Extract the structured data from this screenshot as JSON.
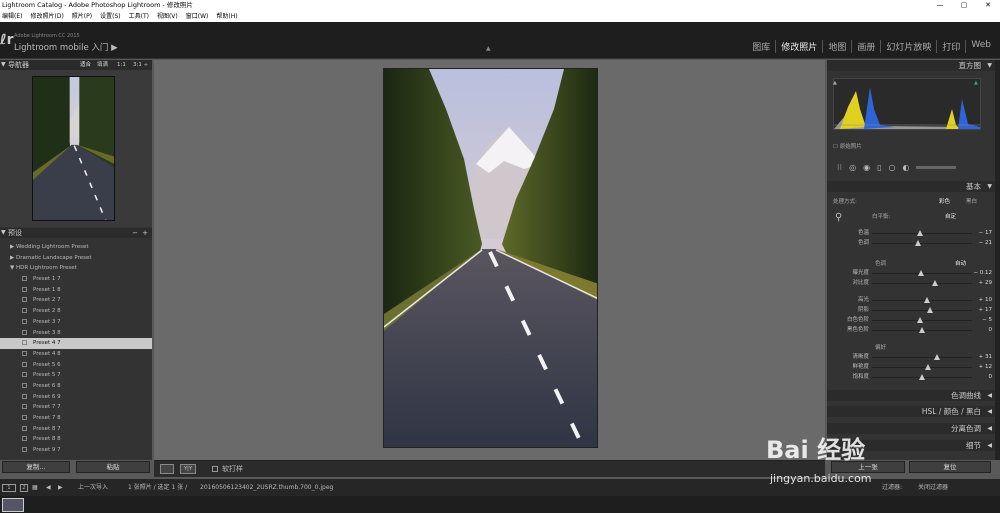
{
  "window": {
    "title": "Lightroom Catalog - Adobe Photoshop Lightroom - 修改照片",
    "min": "—",
    "max": "▢",
    "close": "✕"
  },
  "menu": [
    "编辑(E)",
    "修改照片(D)",
    "照片(P)",
    "设置(S)",
    "工具(T)",
    "视图(V)",
    "窗口(W)",
    "帮助(H)"
  ],
  "brand": {
    "small": "Adobe Lightroom CC 2015",
    "big": "Lightroom mobile 入门 ▶"
  },
  "modules": [
    "图库",
    "修改照片",
    "地图",
    "画册",
    "幻灯片放映",
    "打印",
    "Web"
  ],
  "navigator": {
    "title": "导航器",
    "zoom_options": [
      "适合",
      "填满",
      "1:1",
      "3:1 ÷"
    ]
  },
  "presets": {
    "title": "预设",
    "add": "+",
    "remove": "−",
    "folders": [
      "Wedding Lightroom Preset",
      "Dramatic Landscape Preset",
      "HDR Lightroom Preset"
    ],
    "items": [
      "Preset 1 7",
      "Preset 1 8",
      "Preset 2 7",
      "Preset 2 8",
      "Preset 3 7",
      "Preset 3 8",
      "Preset 4 7",
      "Preset 4 8",
      "Preset 5 6",
      "Preset 5 7",
      "Preset 6 8",
      "Preset 6 9",
      "Preset 7 7",
      "Preset 7 8",
      "Preset 8 7",
      "Preset 8 8",
      "Preset 9 7"
    ],
    "selected_index": 6
  },
  "left_buttons": {
    "copy": "复制...",
    "paste": "粘贴"
  },
  "histogram": {
    "title": "直方图",
    "original_photo": "原始照片"
  },
  "basic": {
    "title": "基本",
    "treatment_label": "处理方式:",
    "color": "彩色",
    "bw": "黑白",
    "wb_label": "白平衡:",
    "wb_value": "自定",
    "tone_label": "色调",
    "auto": "自动",
    "presence_label": "偏好",
    "sliders_wb": [
      {
        "label": "色温",
        "value": "− 17",
        "pos": 0.48
      },
      {
        "label": "色调",
        "value": "− 21",
        "pos": 0.46
      }
    ],
    "sliders_tone1": [
      {
        "label": "曝光度",
        "value": "− 0.12",
        "pos": 0.49
      },
      {
        "label": "对比度",
        "value": "+ 29",
        "pos": 0.63
      }
    ],
    "sliders_tone2": [
      {
        "label": "高光",
        "value": "+ 10",
        "pos": 0.55
      },
      {
        "label": "阴影",
        "value": "+ 17",
        "pos": 0.58
      },
      {
        "label": "白色色阶",
        "value": "− 5",
        "pos": 0.48
      },
      {
        "label": "黑色色阶",
        "value": "0",
        "pos": 0.5
      }
    ],
    "sliders_presence": [
      {
        "label": "清晰度",
        "value": "+ 31",
        "pos": 0.65
      },
      {
        "label": "鲜艳度",
        "value": "+ 12",
        "pos": 0.56
      },
      {
        "label": "饱和度",
        "value": "0",
        "pos": 0.5
      }
    ]
  },
  "panels": {
    "tone_curve": "色调曲线",
    "hsl": "HSL",
    "hsl_color": "颜色",
    "hsl_bw": "黑白",
    "split_toning": "分离色调",
    "detail": "细节"
  },
  "right_buttons": {
    "previous": "上一张",
    "reset": "复位"
  },
  "toolbar": {
    "softproof": "软打样"
  },
  "filmstrip": {
    "num1": "1",
    "num2": "2",
    "source": "上一次导入",
    "count": "1 张照片 / 选定 1 张 /",
    "filename": "20160506123402_2USRZ.thumb.700_0.jpeg",
    "filter_label": "过滤器:",
    "filter_value": "关闭过滤器"
  },
  "watermark": {
    "brand": "Bai 经验",
    "url": "jingyan.baidu.com"
  }
}
